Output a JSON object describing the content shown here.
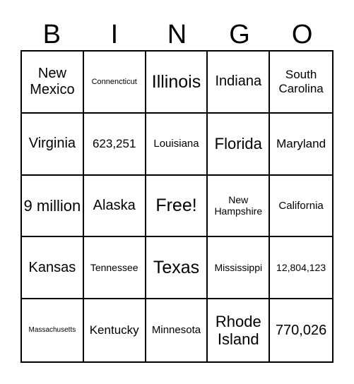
{
  "title_letters": [
    "B",
    "I",
    "N",
    "G",
    "O"
  ],
  "cells": [
    [
      "New Mexico",
      "Connencticut",
      "Illinois",
      "Indiana",
      "South Carolina"
    ],
    [
      "Virginia",
      "623,251",
      "Louisiana",
      "Florida",
      "Maryland"
    ],
    [
      "9 million",
      "Alaska",
      "Free!",
      "New Hampshire",
      "California"
    ],
    [
      "Kansas",
      "Tennessee",
      "Texas",
      "Mississippi",
      "12,804,123"
    ],
    [
      "Massachusetts",
      "Kentucky",
      "Minnesota",
      "Rhode Island",
      "770,026"
    ]
  ]
}
